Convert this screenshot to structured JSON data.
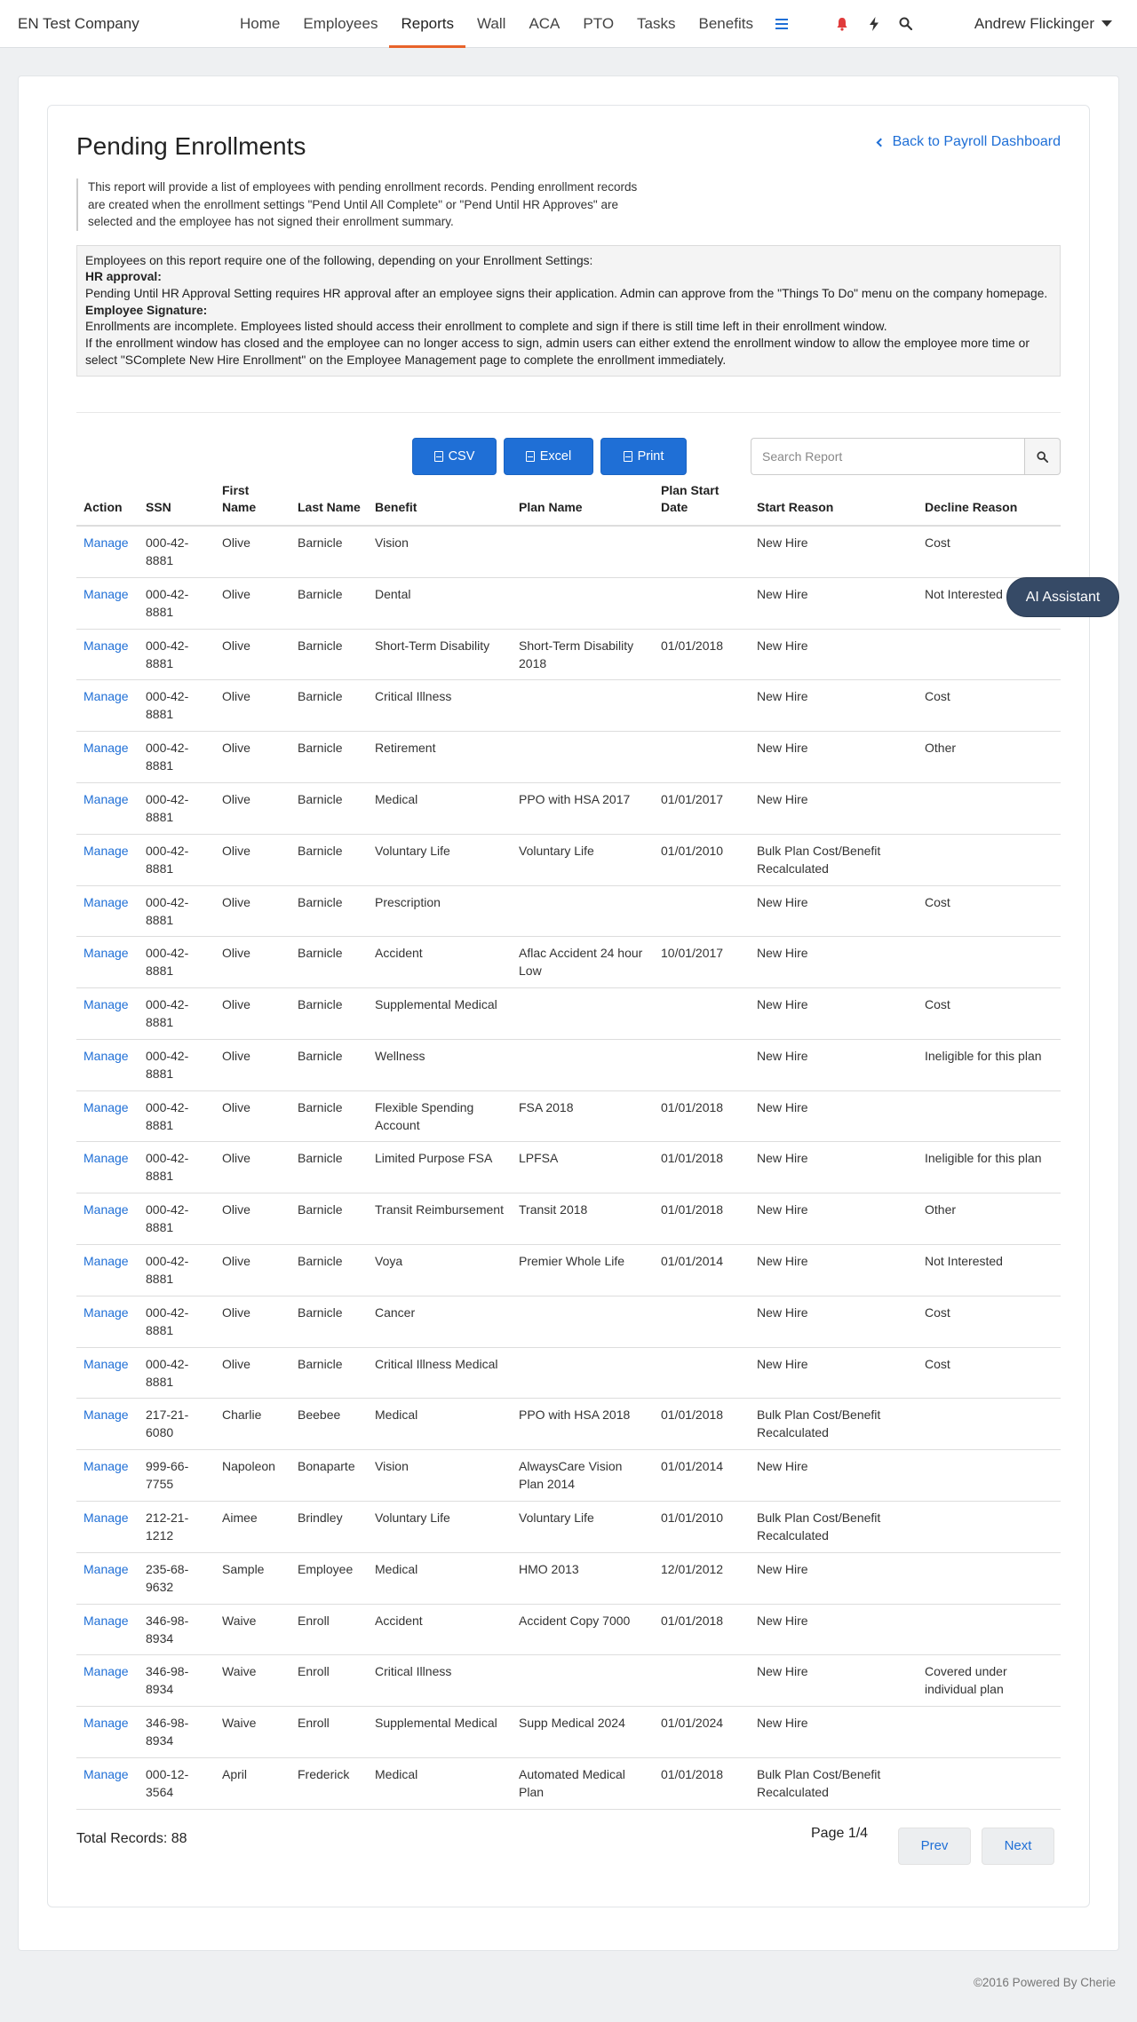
{
  "nav": {
    "brand": "EN Test Company",
    "links": [
      "Home",
      "Employees",
      "Reports",
      "Wall",
      "ACA",
      "PTO",
      "Tasks",
      "Benefits"
    ],
    "active": "Reports",
    "user": "Andrew Flickinger",
    "colors": {
      "accent": "#1f6fd6",
      "active_underline": "#e8632a",
      "bell": "#e03b3b"
    }
  },
  "page": {
    "title": "Pending Enrollments",
    "back_link": "Back to Payroll Dashboard",
    "description": "This report will provide a list of employees with pending enrollment records. Pending enrollment records are created when the enrollment settings \"Pend Until All Complete\" or \"Pend Until HR Approves\" are selected and the employee has not signed their enrollment summary.",
    "info": {
      "intro": "Employees on this report require one of the following, depending on your Enrollment Settings:",
      "hr_heading": "HR approval:",
      "hr_text": "Pending Until HR Approval Setting requires HR approval after an employee signs their application. Admin can approve from the \"Things To Do\" menu on the company homepage.",
      "sig_heading": "Employee Signature:",
      "sig_text1": "Enrollments are incomplete. Employees listed should access their enrollment to complete and sign if there is still time left in their enrollment window.",
      "sig_text2": "If the enrollment window has closed and the employee can no longer access to sign, admin users can either extend the enrollment window to allow the employee more time or select \"SComplete New Hire Enrollment\" on the Employee Management page to complete the enrollment immediately."
    }
  },
  "toolbar": {
    "csv": "CSV",
    "excel": "Excel",
    "print": "Print",
    "search_placeholder": "Search Report"
  },
  "table": {
    "headers": [
      "Action",
      "SSN",
      "First Name",
      "Last Name",
      "Benefit",
      "Plan Name",
      "Plan Start Date",
      "Start Reason",
      "Decline Reason"
    ],
    "rows": [
      [
        "Manage",
        "000-42-8881",
        "Olive",
        "Barnicle",
        "Vision",
        "",
        "",
        "New Hire",
        "Cost"
      ],
      [
        "Manage",
        "000-42-8881",
        "Olive",
        "Barnicle",
        "Dental",
        "",
        "",
        "New Hire",
        "Not Interested"
      ],
      [
        "Manage",
        "000-42-8881",
        "Olive",
        "Barnicle",
        "Short-Term Disability",
        "Short-Term Disability 2018",
        "01/01/2018",
        "New Hire",
        ""
      ],
      [
        "Manage",
        "000-42-8881",
        "Olive",
        "Barnicle",
        "Critical Illness",
        "",
        "",
        "New Hire",
        "Cost"
      ],
      [
        "Manage",
        "000-42-8881",
        "Olive",
        "Barnicle",
        "Retirement",
        "",
        "",
        "New Hire",
        "Other"
      ],
      [
        "Manage",
        "000-42-8881",
        "Olive",
        "Barnicle",
        "Medical",
        "PPO with HSA 2017",
        "01/01/2017",
        "New Hire",
        ""
      ],
      [
        "Manage",
        "000-42-8881",
        "Olive",
        "Barnicle",
        "Voluntary Life",
        "Voluntary Life",
        "01/01/2010",
        "Bulk Plan Cost/Benefit Recalculated",
        ""
      ],
      [
        "Manage",
        "000-42-8881",
        "Olive",
        "Barnicle",
        "Prescription",
        "",
        "",
        "New Hire",
        "Cost"
      ],
      [
        "Manage",
        "000-42-8881",
        "Olive",
        "Barnicle",
        "Accident",
        "Aflac Accident 24 hour Low",
        "10/01/2017",
        "New Hire",
        ""
      ],
      [
        "Manage",
        "000-42-8881",
        "Olive",
        "Barnicle",
        "Supplemental Medical",
        "",
        "",
        "New Hire",
        "Cost"
      ],
      [
        "Manage",
        "000-42-8881",
        "Olive",
        "Barnicle",
        "Wellness",
        "",
        "",
        "New Hire",
        "Ineligible for this plan"
      ],
      [
        "Manage",
        "000-42-8881",
        "Olive",
        "Barnicle",
        "Flexible Spending Account",
        "FSA 2018",
        "01/01/2018",
        "New Hire",
        ""
      ],
      [
        "Manage",
        "000-42-8881",
        "Olive",
        "Barnicle",
        "Limited Purpose FSA",
        "LPFSA",
        "01/01/2018",
        "New Hire",
        "Ineligible for this plan"
      ],
      [
        "Manage",
        "000-42-8881",
        "Olive",
        "Barnicle",
        "Transit Reimbursement",
        "Transit 2018",
        "01/01/2018",
        "New Hire",
        "Other"
      ],
      [
        "Manage",
        "000-42-8881",
        "Olive",
        "Barnicle",
        "Voya",
        "Premier Whole Life",
        "01/01/2014",
        "New Hire",
        "Not Interested"
      ],
      [
        "Manage",
        "000-42-8881",
        "Olive",
        "Barnicle",
        "Cancer",
        "",
        "",
        "New Hire",
        "Cost"
      ],
      [
        "Manage",
        "000-42-8881",
        "Olive",
        "Barnicle",
        "Critical Illness Medical",
        "",
        "",
        "New Hire",
        "Cost"
      ],
      [
        "Manage",
        "217-21-6080",
        "Charlie",
        "Beebee",
        "Medical",
        "PPO with HSA 2018",
        "01/01/2018",
        "Bulk Plan Cost/Benefit Recalculated",
        ""
      ],
      [
        "Manage",
        "999-66-7755",
        "Napoleon",
        "Bonaparte",
        "Vision",
        "AlwaysCare Vision Plan 2014",
        "01/01/2014",
        "New Hire",
        ""
      ],
      [
        "Manage",
        "212-21-1212",
        "Aimee",
        "Brindley",
        "Voluntary Life",
        "Voluntary Life",
        "01/01/2010",
        "Bulk Plan Cost/Benefit Recalculated",
        ""
      ],
      [
        "Manage",
        "235-68-9632",
        "Sample",
        "Employee",
        "Medical",
        "HMO 2013",
        "12/01/2012",
        "New Hire",
        ""
      ],
      [
        "Manage",
        "346-98-8934",
        "Waive",
        "Enroll",
        "Accident",
        "Accident Copy 7000",
        "01/01/2018",
        "New Hire",
        ""
      ],
      [
        "Manage",
        "346-98-8934",
        "Waive",
        "Enroll",
        "Critical Illness",
        "",
        "",
        "New Hire",
        "Covered under individual plan"
      ],
      [
        "Manage",
        "346-98-8934",
        "Waive",
        "Enroll",
        "Supplemental Medical",
        "Supp Medical 2024",
        "01/01/2024",
        "New Hire",
        ""
      ],
      [
        "Manage",
        "000-12-3564",
        "April",
        "Frederick",
        "Medical",
        "Automated Medical Plan",
        "01/01/2018",
        "Bulk Plan Cost/Benefit Recalculated",
        ""
      ]
    ]
  },
  "footer": {
    "total": "Total Records: 88",
    "page": "Page 1/4",
    "prev": "Prev",
    "next": "Next",
    "copyright": "©2016 Powered By Cherie"
  },
  "ai_assistant": "AI Assistant"
}
